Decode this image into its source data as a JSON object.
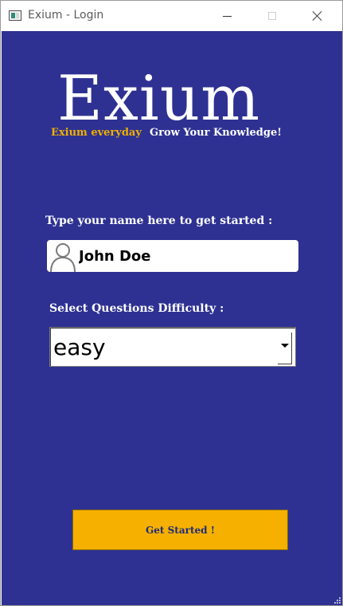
{
  "window": {
    "title": "Exium - Login",
    "background": "#2e3192"
  },
  "brand": {
    "name": "Exium",
    "tagline_accent": "Exium everyday",
    "tagline": "Grow Your Knowledge!",
    "accent_color": "#f0b000"
  },
  "form": {
    "name_label": "Type your name here to get started :",
    "name_value": "John Doe",
    "name_icon": "user-icon",
    "difficulty_label": "Select Questions Difficulty :",
    "difficulty_selected": "easy"
  },
  "actions": {
    "start_label": "Get Started !",
    "start_color": "#f5b000"
  }
}
